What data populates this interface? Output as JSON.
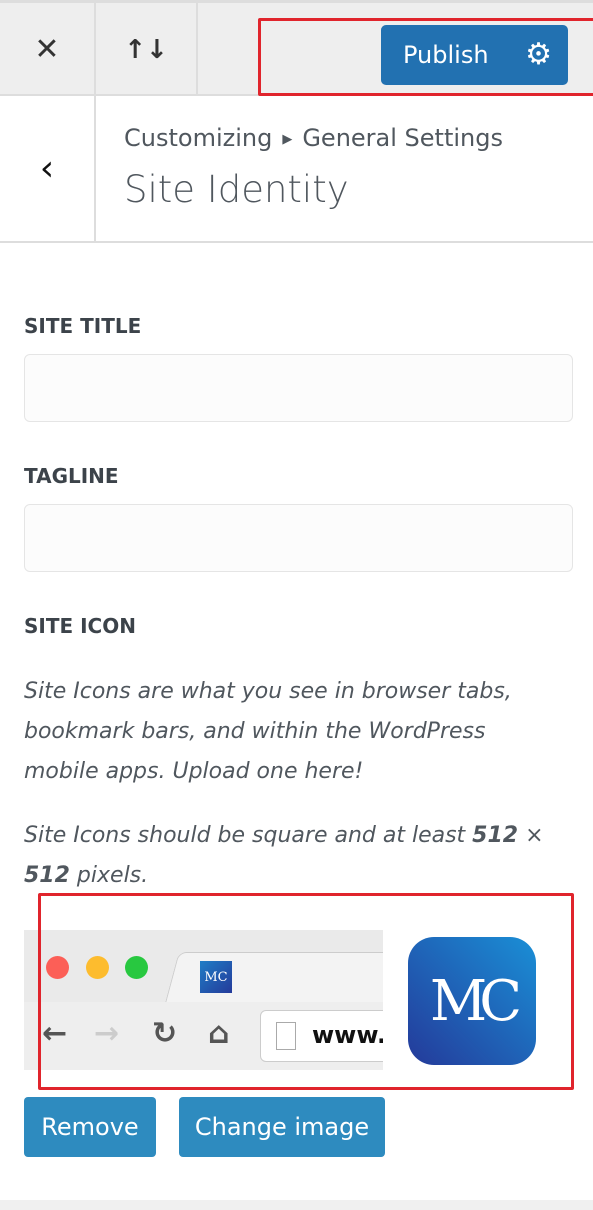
{
  "topbar": {
    "close_icon": "close-icon",
    "reorder_icon": "arrows-up-down-icon",
    "publish_label": "Publish",
    "settings_icon": "gear-icon",
    "publish_color": "#2271b1"
  },
  "header": {
    "breadcrumb_root": "Customizing",
    "breadcrumb_current": "General Settings",
    "title": "Site Identity"
  },
  "fields": {
    "site_title_label": "SITE TITLE",
    "site_title_value": "",
    "tagline_label": "TAGLINE",
    "tagline_value": ""
  },
  "site_icon": {
    "label": "SITE ICON",
    "description": "Site Icons are what you see in browser tabs, bookmark bars, and within the WordPress mobile apps. Upload one here!",
    "size_prefix": "Site Icons should be square and at least ",
    "size_w": "512",
    "size_x": " × ",
    "size_h": "512",
    "size_suffix": " pixels.",
    "url_text": "www.",
    "logo_text": "MC",
    "remove_label": "Remove",
    "change_label": "Change image",
    "button_color": "#2e8bbf"
  },
  "annotation_color": "#e0242c"
}
